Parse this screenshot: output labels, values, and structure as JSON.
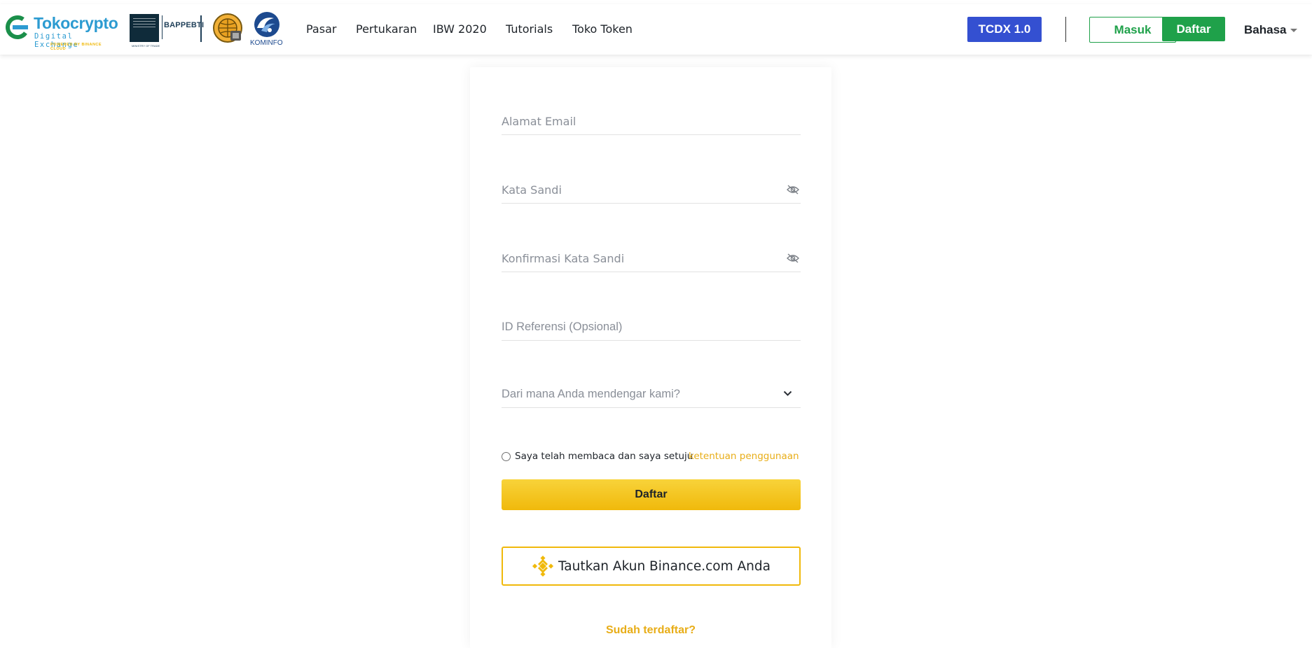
{
  "brand": {
    "name": "Tokocrypto",
    "subtitle": "Digital Exchange",
    "powered_by": "POWERED BY BINANCE CLOUD",
    "accent": "#2c9bd1"
  },
  "partners": {
    "kemendag_text": "KEMENTERIAN PERDAGANGAN REPUBLIK INDONESIA",
    "kemendag_small": "MINISTRY OF TRADE",
    "bappebti": "BAPPEBTI",
    "kominfo": "KOMINFO"
  },
  "nav": {
    "links": [
      "Pasar",
      "Pertukaran",
      "IBW 2020",
      "Tutorials",
      "Toko Token"
    ],
    "tcdx_label": "TCDX 1.0",
    "login_label": "Masuk",
    "signup_label": "Daftar",
    "language_label": "Bahasa"
  },
  "form": {
    "email_placeholder": "Alamat Email",
    "password_placeholder": "Kata Sandi",
    "confirm_password_placeholder": "Konfirmasi Kata Sandi",
    "referral_placeholder": "ID Referensi (Opsional)",
    "source_placeholder": "Dari mana Anda mendengar kami?",
    "terms_text": "Saya telah membaca dan saya setuju",
    "terms_link": "ketentuan penggunaan",
    "submit_label": "Daftar",
    "binance_label": "Tautkan Akun Binance.com Anda",
    "already_registered": "Sudah terdaftar?"
  },
  "colors": {
    "tcdx": "#3450d1",
    "green": "#1fa14a",
    "binance_yellow": "#f0b90b",
    "link_yellow": "#e8ad17"
  },
  "icons": {
    "password_toggle": "eye-off-icon",
    "dropdown": "chevron-down-icon",
    "binance": "binance-logo-icon",
    "language": "caret-down-icon"
  }
}
